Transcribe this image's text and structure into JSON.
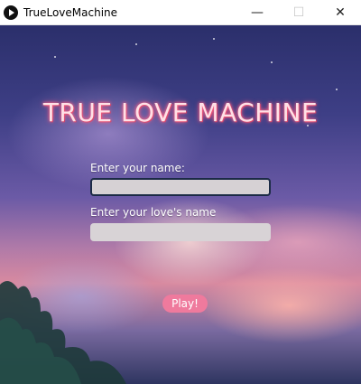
{
  "window": {
    "title": "TrueLoveMachine",
    "icons": {
      "app": "play-icon",
      "minimize": "minimize-icon",
      "maximize": "maximize-icon",
      "close": "close-icon"
    },
    "controls": {
      "minimize": "—",
      "maximize": "☐",
      "close": "✕"
    }
  },
  "main": {
    "heading": "TRUE LOVE MACHINE",
    "name_label": "Enter your name:",
    "name_value": "",
    "love_label": "Enter your love's name",
    "love_value": "",
    "play_label": "Play!"
  },
  "colors": {
    "heading_glow": "#ff4f7a",
    "play_button": "#ef7a9d",
    "input_bg": "#d8d3d6",
    "focused_border": "#1c2b46"
  }
}
